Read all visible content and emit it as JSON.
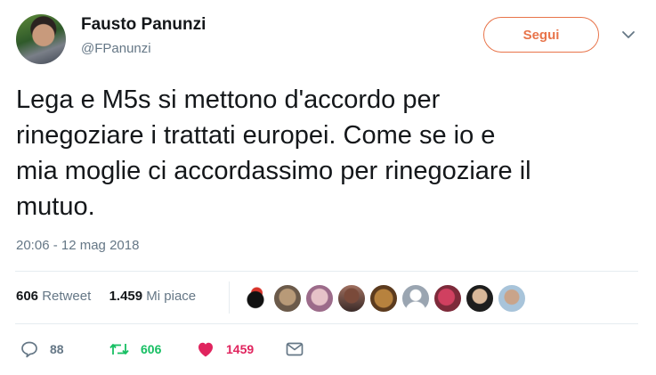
{
  "author": {
    "name": "Fausto Panunzi",
    "handle": "@FPanunzi"
  },
  "follow_label": "Segui",
  "tweet_text": "Lega e M5s si mettono d'accordo per\nrinegoziare i trattati europei. Come se io e\nmia moglie ci accordassimo per rinegoziare il\nmutuo.",
  "timestamp": "20:06 - 12 mag 2018",
  "stats": {
    "retweets": "606",
    "retweets_label": "Retweet",
    "likes": "1.459",
    "likes_label": "Mi piace"
  },
  "actions": {
    "replies": "88",
    "retweets": "606",
    "likes": "1459"
  },
  "colors": {
    "accent": "#e8744a",
    "retweet": "#17bf63",
    "like": "#e0245e",
    "muted": "#657786"
  },
  "icons": [
    "caret-down-icon",
    "reply-icon",
    "retweet-icon",
    "heart-icon",
    "message-icon"
  ]
}
